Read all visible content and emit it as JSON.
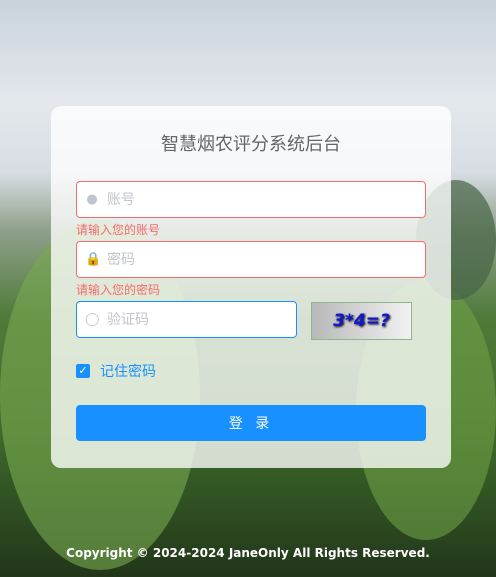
{
  "title": "智慧烟农评分系统后台",
  "username": {
    "placeholder": "账号",
    "value": "",
    "error": "请输入您的账号",
    "icon": "user-icon"
  },
  "password": {
    "placeholder": "密码",
    "value": "",
    "error": "请输入您的密码",
    "icon": "lock-icon"
  },
  "captcha": {
    "placeholder": "验证码",
    "value": "",
    "icon": "shield-icon",
    "image_text": "3*4=?"
  },
  "remember": {
    "label": "记住密码",
    "checked": true
  },
  "login_label": "登 录",
  "footer": "Copyright © 2024-2024 JaneOnly All Rights Reserved.",
  "colors": {
    "primary": "#1890ff",
    "error": "#f56c6c"
  }
}
